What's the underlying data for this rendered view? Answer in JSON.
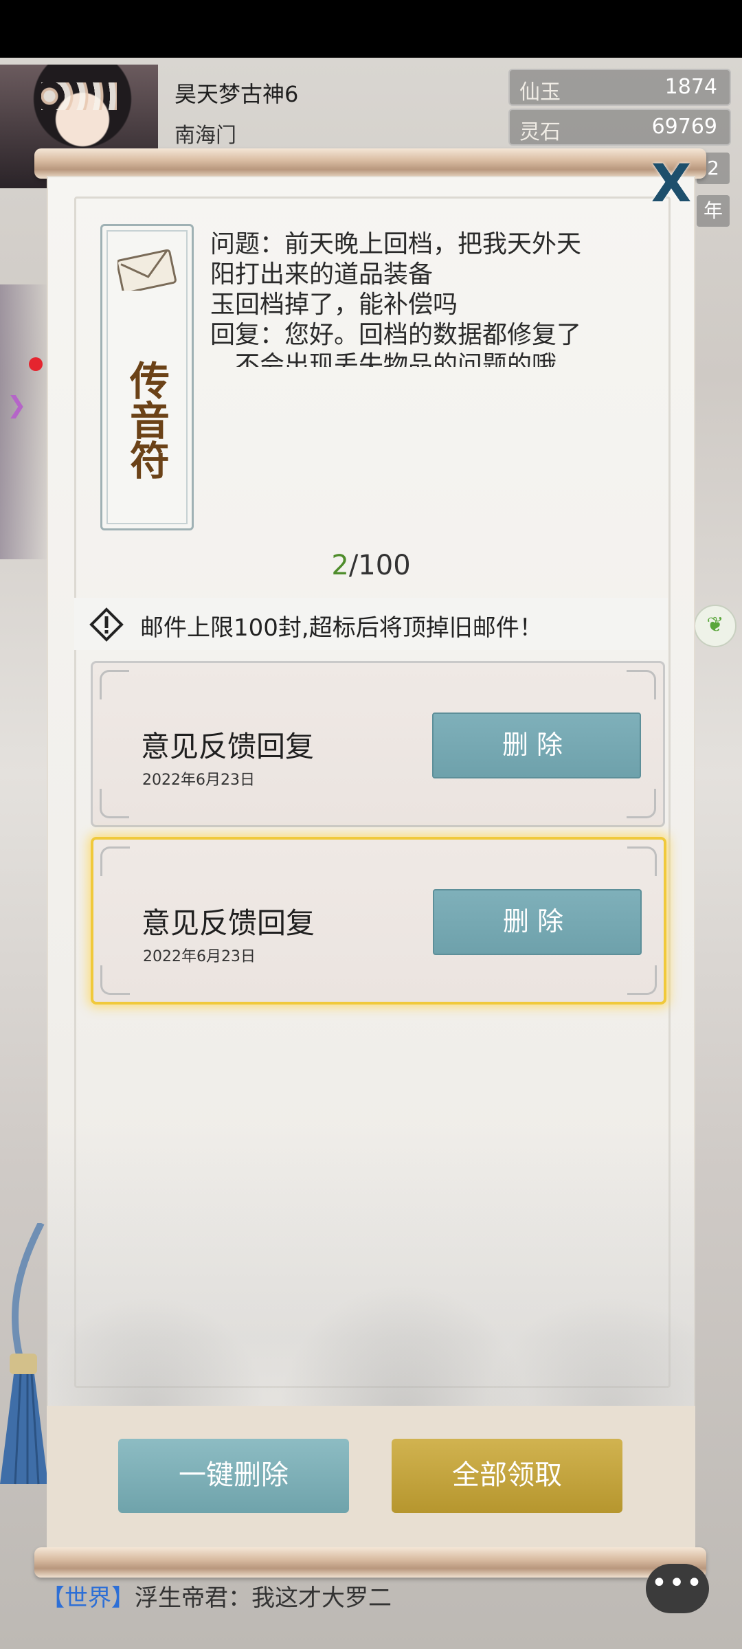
{
  "header": {
    "player_name": "昊天梦古神6",
    "sect": "南海门",
    "resources": [
      {
        "label": "仙玉",
        "value": "1874"
      },
      {
        "label": "灵石",
        "value": "69769"
      }
    ],
    "side_tags": [
      "2",
      "年"
    ]
  },
  "mail_panel": {
    "seal_title": "传音符",
    "message_lines": "问题：前天晚上回档，把我天外天\n阳打出来的道品装备\n玉回档掉了，能补偿吗\n回复：您好。回档的数据都修复了\n，不会出现丢失物品的问题的哦",
    "count_current": "2",
    "count_total": "/100",
    "warning": "邮件上限100封,超标后将顶掉旧邮件！",
    "mails": [
      {
        "title": "意见反馈回复",
        "date": "2022年6月23日",
        "delete_label": "删除"
      },
      {
        "title": "意见反馈回复",
        "date": "2022年6月23日",
        "delete_label": "删除"
      }
    ],
    "delete_all_label": "一键删除",
    "claim_all_label": "全部领取",
    "close_label": "X"
  },
  "chat": {
    "channel": "【世界】",
    "message": "浮生帝君：我这才大罗二",
    "bubble": "•••"
  },
  "colors": {
    "delete_button": "#7fb0ba",
    "claim_button": "#c4a43e",
    "selected_border": "#f0c93b",
    "counter_current": "#4f8d2c"
  }
}
